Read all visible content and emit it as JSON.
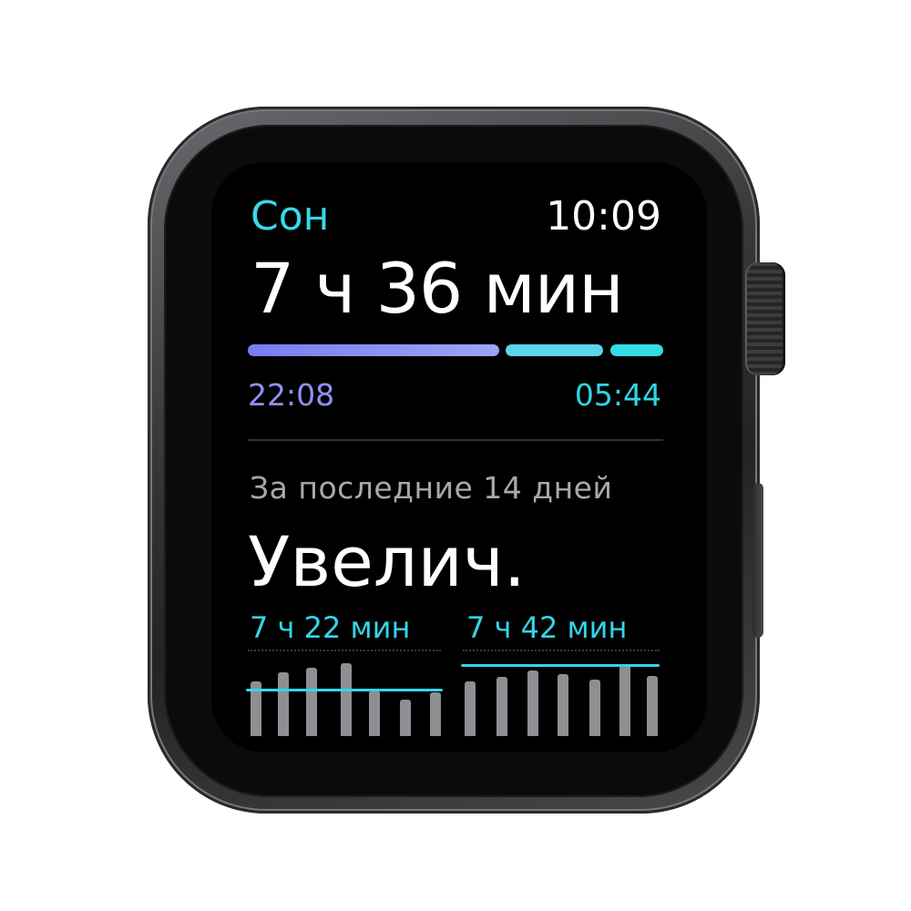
{
  "app": {
    "title": "Сон",
    "clock": "10:09"
  },
  "sleep": {
    "duration": "7 ч 36 мин",
    "start_time": "22:08",
    "end_time": "05:44"
  },
  "trend": {
    "period": "За последние 14 дней",
    "status": "Увелич.",
    "previous_avg": "7 ч 22 мин",
    "current_avg": "7 ч 42 мин"
  },
  "colors": {
    "accent_cyan": "#3ad7e6",
    "accent_purple": "#8f91f2",
    "chart_bar": "#8e8e93"
  },
  "icons": [
    "digital-crown",
    "side-button"
  ]
}
